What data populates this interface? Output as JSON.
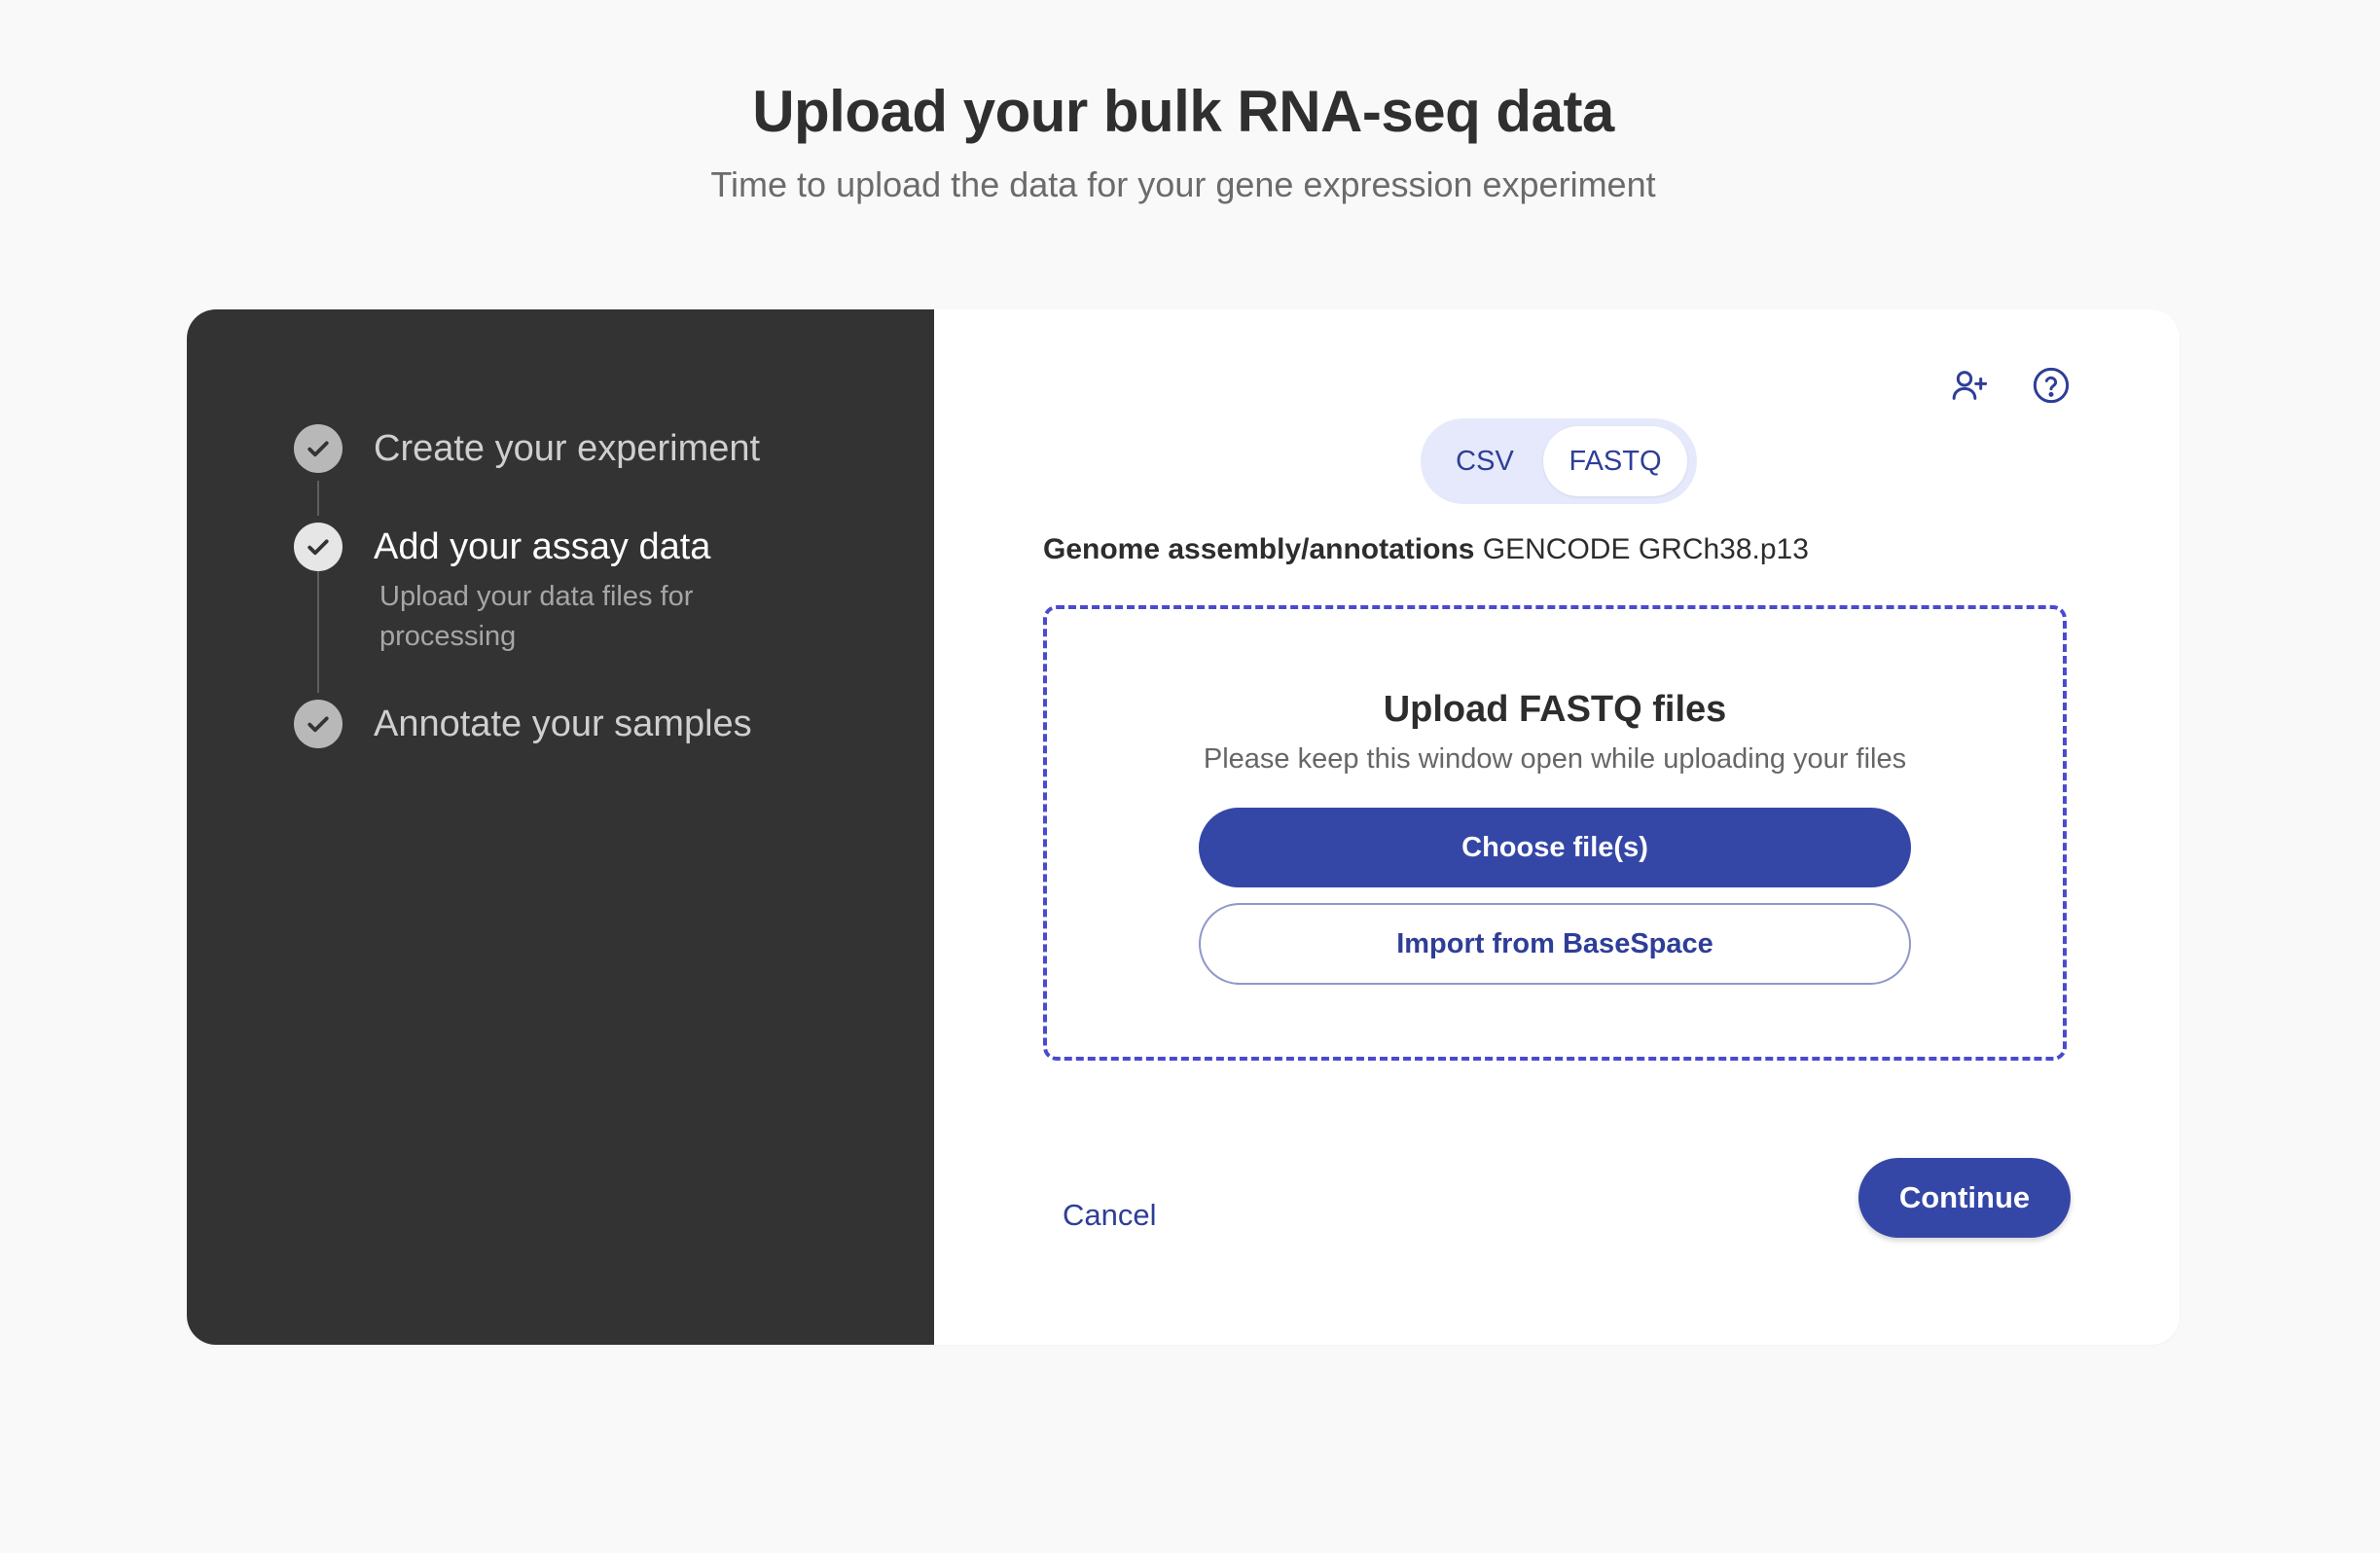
{
  "header": {
    "title": "Upload your bulk RNA-seq data",
    "subtitle": "Time to upload the data for your gene expression experiment"
  },
  "stepper": {
    "steps": [
      {
        "title": "Create your experiment",
        "description": "",
        "state": "completed"
      },
      {
        "title": "Add your assay data",
        "description": "Upload your data files for processing",
        "state": "active"
      },
      {
        "title": "Annotate your samples",
        "description": "",
        "state": "completed"
      }
    ]
  },
  "toolbar": {
    "icons": [
      "add-user-icon",
      "help-icon"
    ]
  },
  "format_toggle": {
    "options": [
      "CSV",
      "FASTQ"
    ],
    "selected": "FASTQ"
  },
  "genome": {
    "label": "Genome assembly/annotations",
    "value": "GENCODE GRCh38.p13"
  },
  "dropzone": {
    "title": "Upload FASTQ files",
    "note": "Please keep this window open while uploading your files",
    "choose_label": "Choose file(s)",
    "import_label": "Import from BaseSpace"
  },
  "footer": {
    "cancel_label": "Cancel",
    "continue_label": "Continue"
  },
  "colors": {
    "primary": "#3547a6",
    "sidebar_bg": "#333333",
    "toggle_bg": "#e5e9fb",
    "dropzone_border": "#4a4ad0"
  }
}
